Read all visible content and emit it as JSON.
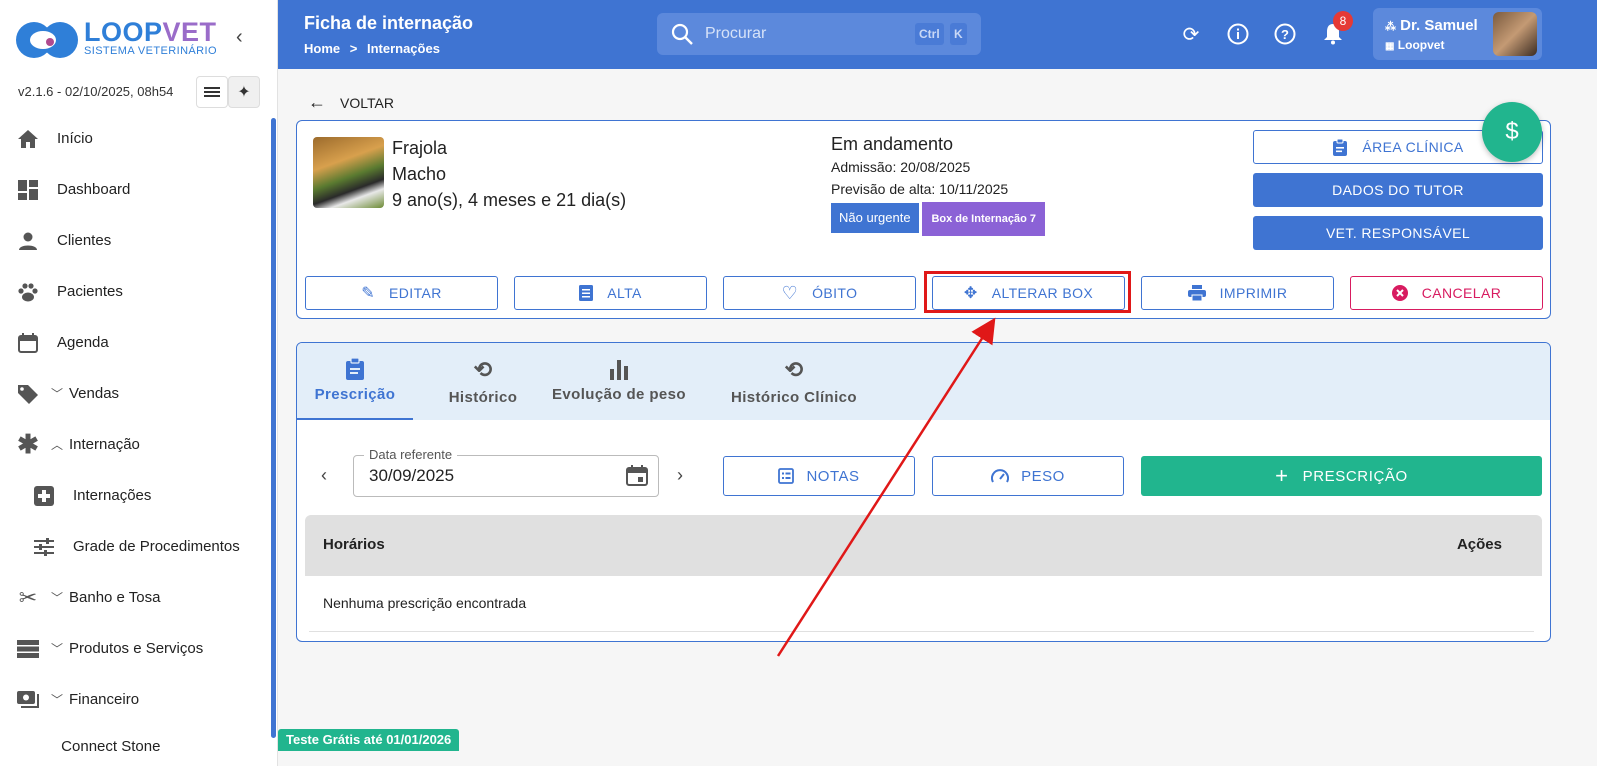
{
  "sidebar": {
    "logo_main": "LOOPVET",
    "logo_sub": "SISTEMA VETERINÁRIO",
    "version": "v2.1.6 - 02/10/2025, 08h54",
    "items": [
      {
        "label": "Início"
      },
      {
        "label": "Dashboard"
      },
      {
        "label": "Clientes"
      },
      {
        "label": "Pacientes"
      },
      {
        "label": "Agenda"
      },
      {
        "label": "Vendas"
      },
      {
        "label": "Internação"
      },
      {
        "label": "Internações"
      },
      {
        "label": "Grade de Procedimentos"
      },
      {
        "label": "Banho e Tosa"
      },
      {
        "label": "Produtos e Serviços"
      },
      {
        "label": "Financeiro"
      },
      {
        "label": "Connect Stone"
      }
    ]
  },
  "header": {
    "title": "Ficha de internação",
    "breadcrumb": {
      "home": "Home",
      "sep": ">",
      "current": "Internações"
    },
    "search": {
      "placeholder": "Procurar",
      "key1": "Ctrl",
      "key2": "K"
    },
    "notifications_count": "8",
    "user": {
      "name": "Dr. Samuel",
      "org": "Loopvet"
    }
  },
  "page": {
    "back_label": "VOLTAR",
    "fab_symbol": "$",
    "patient": {
      "name": "Frajola",
      "sex": "Macho",
      "age": "9 ano(s), 4 meses e 21 dia(s)"
    },
    "status": {
      "title": "Em andamento",
      "admission": "Admissão: 20/08/2025",
      "discharge_forecast": "Previsão de alta: 10/11/2025",
      "urgency": "Não urgente",
      "box": "Box de Internação 7",
      "urgency_color": "#3f74d2",
      "box_color": "#8b62d6"
    },
    "side_buttons": {
      "clinical_area": "ÁREA CLÍNICA",
      "tutor_data": "DADOS DO TUTOR",
      "vet_responsible": "VET. RESPONSÁVEL"
    },
    "actions": {
      "edit": "EDITAR",
      "discharge": "ALTA",
      "death": "ÓBITO",
      "change_box": "ALTERAR BOX",
      "print": "IMPRIMIR",
      "cancel": "CANCELAR"
    },
    "tabs": [
      {
        "label": "Prescrição"
      },
      {
        "label": "Histórico"
      },
      {
        "label": "Evolução de peso"
      },
      {
        "label": "Histórico Clínico"
      }
    ],
    "date_field": {
      "label": "Data referente",
      "value": "30/09/2025"
    },
    "notes_label": "NOTAS",
    "weight_label": "PESO",
    "add_prescription_label": "PRESCRIÇÃO",
    "table": {
      "col_times": "Horários",
      "col_actions": "Ações",
      "empty": "Nenhuma prescrição encontrada"
    },
    "trial_badge": "Teste Grátis até 01/01/2026"
  },
  "colors": {
    "primary": "#3f74d2",
    "success": "#21b58e",
    "danger": "#d81b60",
    "annotation": "#e01818"
  }
}
